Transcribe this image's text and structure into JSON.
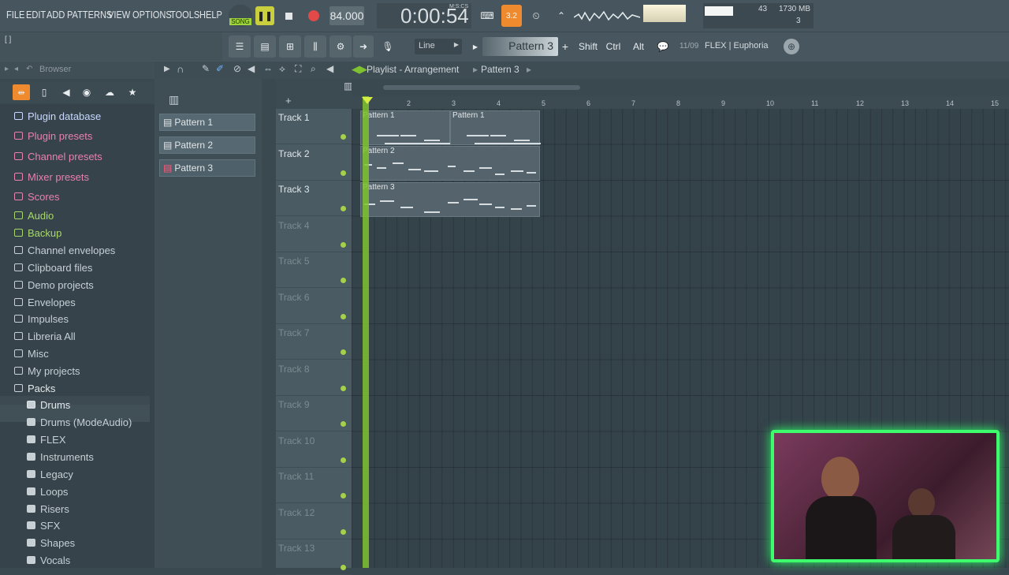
{
  "menu": [
    "FILE",
    "EDIT",
    "ADD",
    "PATTERNS",
    "VIEW",
    "OPTIONS",
    "TOOLS",
    "HELP"
  ],
  "transport": {
    "mode": "SONG",
    "tempo": "84.000",
    "time": "0:00:54",
    "time_unit": "M:S:CS"
  },
  "stats": {
    "cpu": "43",
    "memory": "1730 MB",
    "poly": "3"
  },
  "toolbar2": {
    "brackets": "[ ]",
    "snap": "Line",
    "pattern": "Pattern 3",
    "shift": "Shift",
    "ctrl": "Ctrl",
    "alt": "Alt",
    "plugin_info": "11/09",
    "plugin_name": "FLEX | Euphoria"
  },
  "browser": {
    "title": "Browser",
    "items": [
      {
        "label": "Plugin database",
        "color": "#c8d8ff"
      },
      {
        "label": "Plugin presets",
        "color": "#e880b0"
      },
      {
        "label": "Channel presets",
        "color": "#e880b0"
      },
      {
        "label": "Mixer presets",
        "color": "#e880b0"
      },
      {
        "label": "Scores",
        "color": "#e880b0"
      },
      {
        "label": "Audio",
        "color": "#a6d86a"
      },
      {
        "label": "Backup",
        "color": "#a6d86a"
      },
      {
        "label": "Channel envelopes",
        "color": "#c6d0d5"
      },
      {
        "label": "Clipboard files",
        "color": "#c6d0d5"
      },
      {
        "label": "Demo projects",
        "color": "#c6d0d5"
      },
      {
        "label": "Envelopes",
        "color": "#c6d0d5"
      },
      {
        "label": "Impulses",
        "color": "#c6d0d5"
      },
      {
        "label": "Libreria All",
        "color": "#c6d0d5"
      },
      {
        "label": "Misc",
        "color": "#c6d0d5"
      },
      {
        "label": "My projects",
        "color": "#c6d0d5"
      },
      {
        "label": "Packs",
        "color": "#c6d0d5"
      },
      {
        "label": "Drums",
        "color": "#e0e6e8"
      },
      {
        "label": "Drums (ModeAudio)",
        "color": "#c6d0d5"
      },
      {
        "label": "FLEX",
        "color": "#c6d0d5"
      },
      {
        "label": "Instruments",
        "color": "#c6d0d5"
      },
      {
        "label": "Legacy",
        "color": "#c6d0d5"
      },
      {
        "label": "Loops",
        "color": "#c6d0d5"
      },
      {
        "label": "Risers",
        "color": "#c6d0d5"
      },
      {
        "label": "SFX",
        "color": "#c6d0d5"
      },
      {
        "label": "Shapes",
        "color": "#c6d0d5"
      },
      {
        "label": "Vocals",
        "color": "#c6d0d5"
      }
    ]
  },
  "playlist": {
    "breadcrumb": [
      "Playlist - Arrangement",
      "Pattern 3"
    ],
    "patterns": [
      "Pattern 1",
      "Pattern 2",
      "Pattern 3"
    ],
    "tracks": [
      "Track 1",
      "Track 2",
      "Track 3",
      "Track 4",
      "Track 5",
      "Track 6",
      "Track 7",
      "Track 8",
      "Track 9",
      "Track 10",
      "Track 11",
      "Track 12",
      "Track 13"
    ],
    "bars": [
      "2",
      "3",
      "4",
      "5",
      "6",
      "7",
      "8",
      "9",
      "10",
      "11",
      "12",
      "13",
      "14",
      "15"
    ],
    "clips": [
      {
        "label": "Pattern 1"
      },
      {
        "label": "Pattern 1"
      },
      {
        "label": "Pattern 2"
      },
      {
        "label": "Pattern 3"
      }
    ]
  },
  "colors": {
    "accent": "#7fc22f",
    "webcam_border": "#3dfd6c"
  }
}
